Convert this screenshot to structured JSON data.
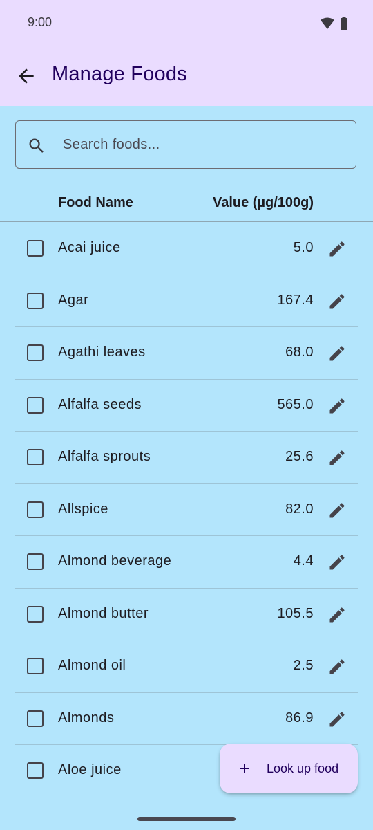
{
  "status_bar": {
    "time": "9:00",
    "icons": [
      "wifi-icon",
      "battery-icon"
    ]
  },
  "app_bar": {
    "title": "Manage Foods",
    "back_icon": "arrow-back-icon"
  },
  "search": {
    "placeholder": "Search foods...",
    "value": "",
    "icon": "search-icon"
  },
  "table": {
    "headers": {
      "name": "Food Name",
      "value": "Value (µg/100g)"
    },
    "rows": [
      {
        "name": "Acai juice",
        "value": "5.0"
      },
      {
        "name": "Agar",
        "value": "167.4"
      },
      {
        "name": "Agathi leaves",
        "value": "68.0"
      },
      {
        "name": "Alfalfa seeds",
        "value": "565.0"
      },
      {
        "name": "Alfalfa sprouts",
        "value": "25.6"
      },
      {
        "name": "Allspice",
        "value": "82.0"
      },
      {
        "name": "Almond beverage",
        "value": "4.4"
      },
      {
        "name": "Almond butter",
        "value": "105.5"
      },
      {
        "name": "Almond oil",
        "value": "2.5"
      },
      {
        "name": "Almonds",
        "value": "86.9"
      },
      {
        "name": "Aloe juice",
        "value": ""
      }
    ]
  },
  "fab": {
    "label": "Look up food",
    "icon": "plus-icon"
  },
  "colors": {
    "background": "#b3e5fc",
    "app_bar": "#eadcff",
    "title": "#21005d"
  }
}
